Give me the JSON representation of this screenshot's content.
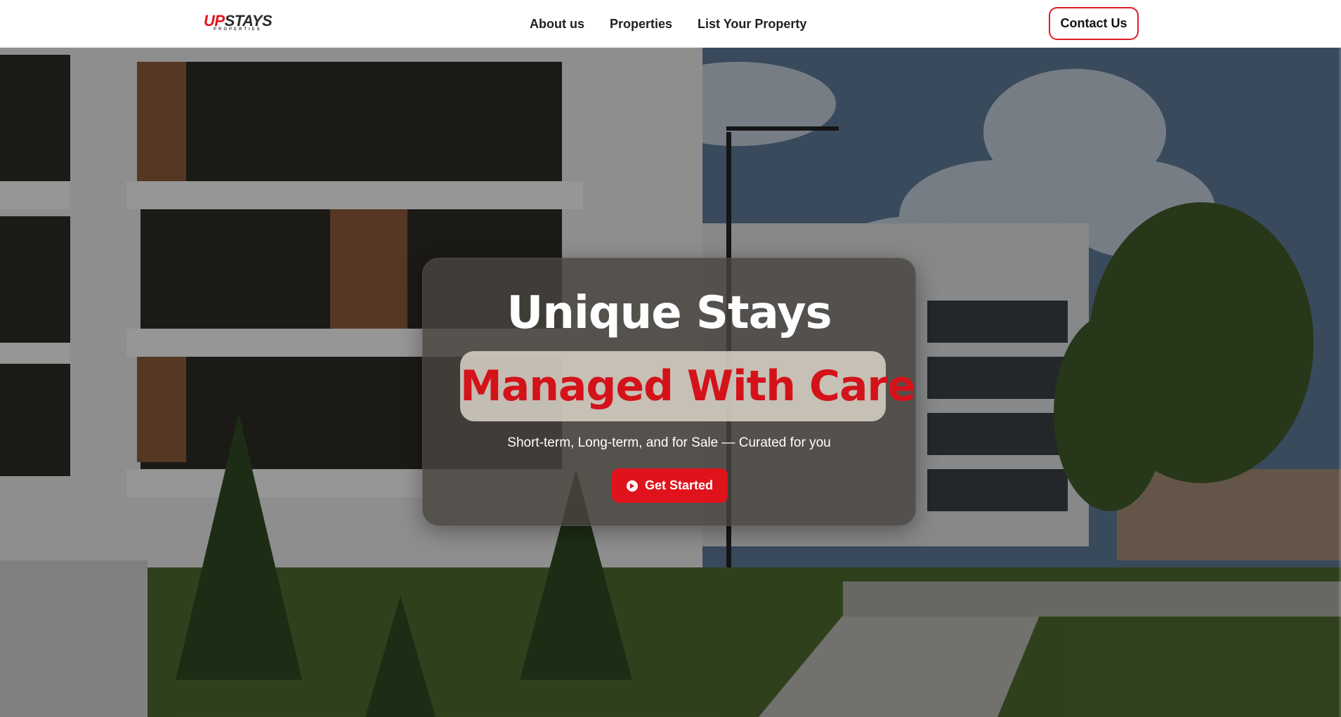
{
  "brand": {
    "logo_up": "UP",
    "logo_stays": "STAYS",
    "logo_sub": "PROPERTIES",
    "accent_color": "#e4141c"
  },
  "nav": {
    "links": [
      "About us",
      "Properties",
      "List Your Property"
    ],
    "contact_label": "Contact Us"
  },
  "hero": {
    "background_image": "modern-apartment-buildings-photo",
    "headline": "Unique Stays",
    "highlight": "Managed With Care",
    "subtitle": "Short-term, Long-term, and for Sale — Curated for you",
    "cta_label": "Get Started",
    "cta_icon": "arrow-circle-right-icon"
  }
}
